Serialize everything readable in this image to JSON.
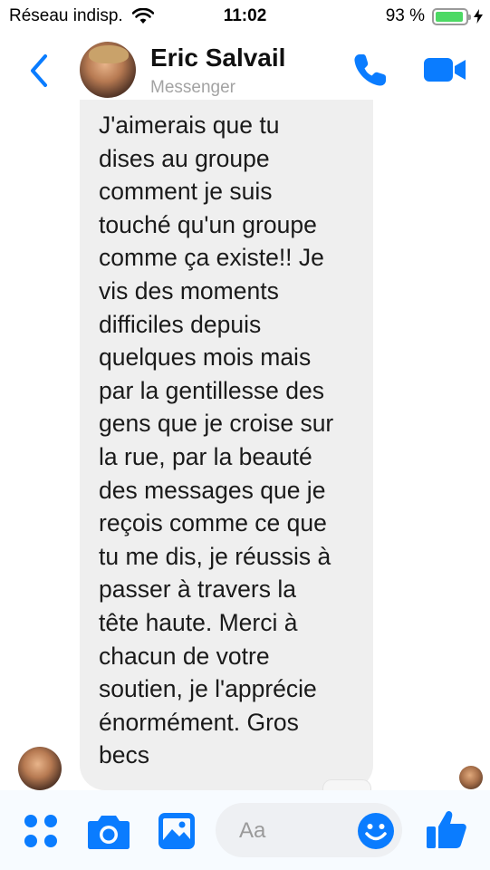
{
  "status_bar": {
    "carrier": "Réseau indisp.",
    "time": "11:02",
    "battery_percent": "93 %",
    "battery_level": 0.93
  },
  "header": {
    "contact_name": "Eric Salvail",
    "subtitle": "Messenger",
    "accent_color": "#0a7cff"
  },
  "thread": {
    "message_text": "J'aimerais que tu\ndises au groupe\ncomment je suis\ntouché qu'un groupe\ncomme ça existe!! Je\nvis des moments\ndifficiles depuis\nquelques mois mais\npar la gentillesse des\ngens que je croise sur\nla rue, par la beauté\ndes messages que je\nreçois comme ce que\ntu me dis, je réussis à\npasser à travers la\ntête haute. Merci à\nchacun de votre\nsoutien, je l'apprécie\nénormément. Gros\nbecs"
  },
  "composer": {
    "placeholder": "Aa",
    "icons": [
      "four-dots-icon",
      "camera-icon",
      "photo-icon",
      "emoji-icon",
      "thumbs-up-icon"
    ]
  }
}
